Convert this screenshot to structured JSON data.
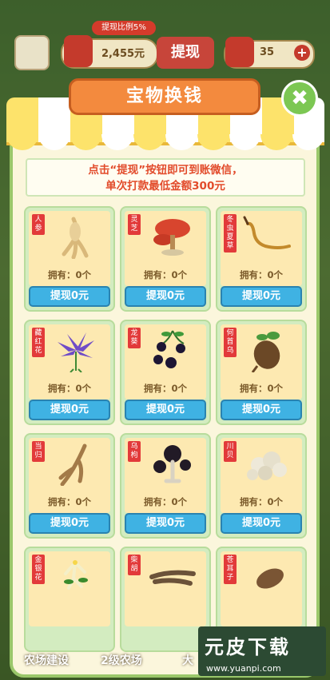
{
  "hud": {
    "money_tag": "提现比例5%",
    "money_value": "2,455元",
    "withdraw_label": "提现",
    "hearts": "35",
    "plus": "+"
  },
  "title": "宝物换钱",
  "close": "✖",
  "notice": {
    "line1": "点击“提现”按钮即可到账微信，",
    "line2": "单次打款最低金额300元"
  },
  "items": [
    {
      "tag": "人参",
      "own": "拥有：0个",
      "btn": "提现0元"
    },
    {
      "tag": "灵芝",
      "own": "拥有：0个",
      "btn": "提现0元"
    },
    {
      "tag": "冬虫夏草",
      "own": "拥有：0个",
      "btn": "提现0元"
    },
    {
      "tag": "藏红花",
      "own": "拥有：0个",
      "btn": "提现0元"
    },
    {
      "tag": "龙葵",
      "own": "拥有：0个",
      "btn": "提现0元"
    },
    {
      "tag": "何首乌",
      "own": "拥有：0个",
      "btn": "提现0元"
    },
    {
      "tag": "当归",
      "own": "拥有：0个",
      "btn": "提现0元"
    },
    {
      "tag": "乌枸",
      "own": "拥有：0个",
      "btn": "提现0元"
    },
    {
      "tag": "川贝",
      "own": "拥有：0个",
      "btn": "提现0元"
    },
    {
      "tag": "金银花",
      "own": "",
      "btn": ""
    },
    {
      "tag": "柴胡",
      "own": "",
      "btn": ""
    },
    {
      "tag": "苍耳子",
      "own": "",
      "btn": ""
    }
  ],
  "bottom_nav": {
    "farm_build": "农场建设",
    "farm_level": "2级农场",
    "extra": "大"
  },
  "watermark": {
    "main": "元皮下载",
    "url": "www.yuanpi.com"
  },
  "colors": {
    "accent_orange": "#f38a3e",
    "button_blue": "#3fb2e3",
    "tag_red": "#e23a3a",
    "notice_red": "#e24b2b"
  }
}
